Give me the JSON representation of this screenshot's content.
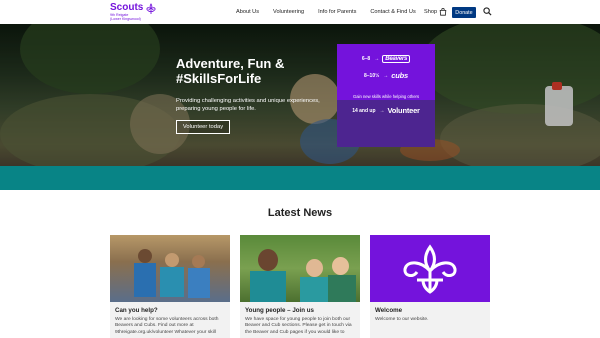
{
  "header": {
    "logo_text": "Scouts",
    "logo_sub1": "9th Reigate",
    "logo_sub2": "(Lower Kingswood)",
    "nav": [
      "About Us",
      "Volunteering",
      "Info for Parents",
      "Contact & Find Us"
    ],
    "shop_label": "Shop",
    "donate_label": "Donate"
  },
  "hero": {
    "title": "Adventure, Fun & #SkillsForLife",
    "text": "Providing challenging activities and unique experiences, preparing young people for life.",
    "button": "Volunteer today"
  },
  "sections": {
    "rows": [
      {
        "age": "6–8",
        "name": "Beavers"
      },
      {
        "age": "8–10½",
        "name": "cubs"
      }
    ],
    "tagline": "Gain new skills while helping others",
    "explorer_age": "14 and up",
    "explorer_name": "Volunteer"
  },
  "news": {
    "heading": "Latest News",
    "cards": [
      {
        "title": "Can you help?",
        "text": "We are looking for some volunteers across both Beavers and Cubs. Find out more at 9threigate.org.uk/volunteer Whatever your skill"
      },
      {
        "title": "Young people – Join us",
        "text": "We have space for young people to join both our Beaver and Cub sections. Please get in touch via the Beaver and Cub pages if you would like to"
      },
      {
        "title": "Welcome",
        "text": "Welcome to our website."
      }
    ]
  },
  "colors": {
    "purple": "#7413dc",
    "teal": "#088486",
    "navy": "#003982",
    "dark_purple": "#4d2590"
  },
  "icons": {
    "logo": "fleur-de-lis-icon",
    "shop": "shopping-bag-icon",
    "search": "search-icon"
  }
}
